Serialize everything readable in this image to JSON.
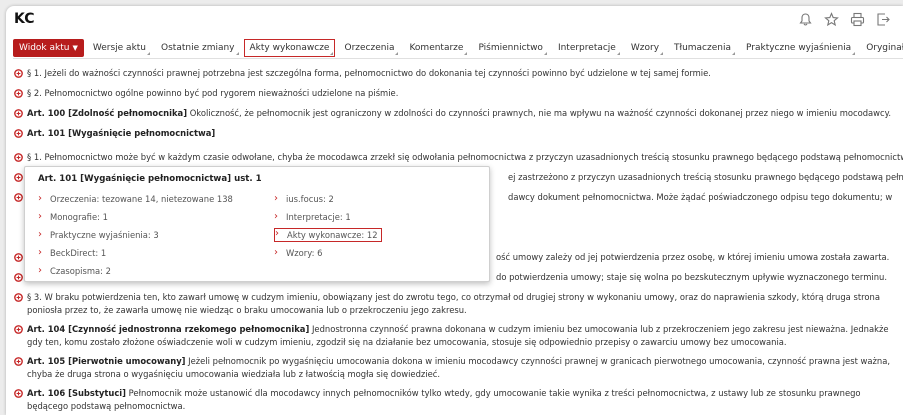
{
  "title": "KC",
  "icons": {
    "bell": "bell-icon",
    "star": "star-icon",
    "print": "print-icon",
    "export": "export-icon",
    "para": "expand-plus-icon",
    "chevron": "chevron-right-icon"
  },
  "colors": {
    "accent": "#b71c1c",
    "highlight": "#c62828"
  },
  "tabs": [
    {
      "label": "Widok aktu",
      "active": true,
      "dropdown": true
    },
    {
      "label": "Wersje aktu"
    },
    {
      "label": "Ostatnie zmiany"
    },
    {
      "label": "Akty wykonawcze",
      "highlight": true
    },
    {
      "label": "Orzeczenia"
    },
    {
      "label": "Komentarze"
    },
    {
      "label": "Piśmiennictwo"
    },
    {
      "label": "Interpretacje"
    },
    {
      "label": "Wzory"
    },
    {
      "label": "Tłumaczenia"
    },
    {
      "label": "Praktyczne wyjaśnienia"
    },
    {
      "label": "Oryginał"
    }
  ],
  "paragraphs": [
    {
      "text": "§ 1. Jeżeli do ważności czynności prawnej potrzebna jest szczególna forma, pełnomocnictwo do dokonania tej czynności powinno być udzielone w tej samej formie."
    },
    {
      "text": "§ 2. Pełnomocnictwo ogólne powinno być pod rygorem nieważności udzielone na piśmie."
    },
    {
      "bold": "Art. 100 [Zdolność pełnomocnika]",
      "text": " Okoliczność, że pełnomocnik jest ograniczony w zdolności do czynności prawnych, nie ma wpływu na ważność czynności dokonanej przez niego w imieniu mocodawcy."
    },
    {
      "bold": "Art. 101 [Wygaśnięcie pełnomocnictwa]",
      "text": ""
    },
    {
      "text": "§ 1. Pełnomocnictwo może być w każdym czasie odwołane, chyba że mocodawca zrzekł się odwołania pełnomocnictwa z przyczyn uzasadnionych treścią stosunku prawnego będącego podstawą pełnomocnictwa."
    },
    {
      "text": "ej zastrzeżono z przyczyn uzasadnionych treścią stosunku prawnego będącego podstawą pełnomocnictwa."
    },
    {
      "text": "dawcy dokument pełnomocnictwa. Może żądać poświadczonego odpisu tego dokumentu; w"
    },
    {
      "text": ""
    },
    {
      "text": ""
    },
    {
      "text": "ość umowy zależy od jej potwierdzenia przez osobę, w której imieniu umowa została zawarta."
    },
    {
      "text": "do potwierdzenia umowy; staje się wolna po bezskutecznym upływie wyznaczonego terminu."
    },
    {
      "text": "§ 3. W braku potwierdzenia ten, kto zawarł umowę w cudzym imieniu, obowiązany jest do zwrotu tego, co otrzymał od drugiej strony w wykonaniu umowy, oraz do naprawienia szkody, którą druga strona poniosła przez to, że zawarła umowę nie wiedząc o braku umocowania lub o przekroczeniu jego zakresu."
    },
    {
      "bold": "Art. 104 [Czynność jednostronna rzekomego pełnomocnika]",
      "text": " Jednostronna czynność prawna dokonana w cudzym imieniu bez umocowania lub z przekroczeniem jego zakresu jest nieważna. Jednakże gdy ten, komu zostało złożone oświadczenie woli w cudzym imieniu, zgodził się na działanie bez umocowania, stosuje się odpowiednio przepisy o zawarciu umowy bez umocowania."
    },
    {
      "bold": "Art. 105 [Pierwotnie umocowany]",
      "text": " Jeżeli pełnomocnik po wygaśnięciu umocowania dokona w imieniu mocodawcy czynności prawnej w granicach pierwotnego umocowania, czynność prawna jest ważna, chyba że druga strona o wygaśnięciu umocowania wiedziała lub z łatwością mogła się dowiedzieć."
    },
    {
      "bold": "Art. 106 [Substytuci]",
      "text": " Pełnomocnik może ustanowić dla mocodawcy innych pełnomocników tylko wtedy, gdy umocowanie takie wynika z treści pełnomocnictwa, z ustawy lub ze stosunku prawnego będącego podstawą pełnomocnictwa."
    }
  ],
  "popup": {
    "title": "Art. 101 [Wygaśnięcie pełnomocnictwa] ust. 1",
    "left_links": [
      "Orzeczenia: tezowane 14, nietezowane 138",
      "Monografie: 1",
      "Praktyczne wyjaśnienia: 3",
      "BeckDirect: 1",
      "Czasopisma: 2"
    ],
    "right_links": [
      "ius.focus: 2",
      "Interpretacje: 1",
      "Akty wykonawcze: 12",
      "Wzory: 6"
    ]
  }
}
